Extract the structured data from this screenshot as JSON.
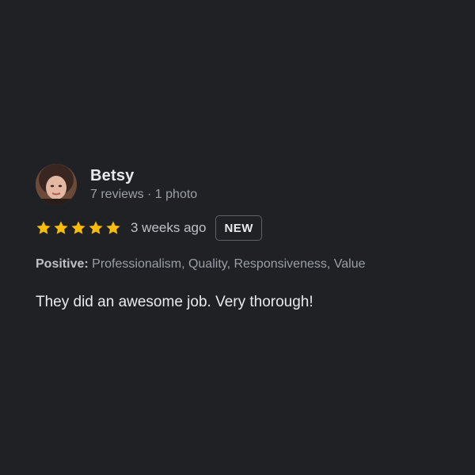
{
  "review": {
    "author_name": "Betsy",
    "author_meta": "7 reviews · 1 photo",
    "rating": 5,
    "rating_max": 5,
    "time_ago": "3 weeks ago",
    "badge": "NEW",
    "attributes_label": "Positive:",
    "attributes_value": "Professionalism, Quality, Responsiveness, Value",
    "text": "They did an awesome job. Very thorough!"
  },
  "colors": {
    "background": "#202124",
    "star": "#fbbc04",
    "primary_text": "#e8eaed",
    "secondary_text": "#9aa0a6",
    "badge_border": "#5f6368"
  },
  "icons": {
    "star": "star-icon",
    "avatar": "profile-photo"
  }
}
